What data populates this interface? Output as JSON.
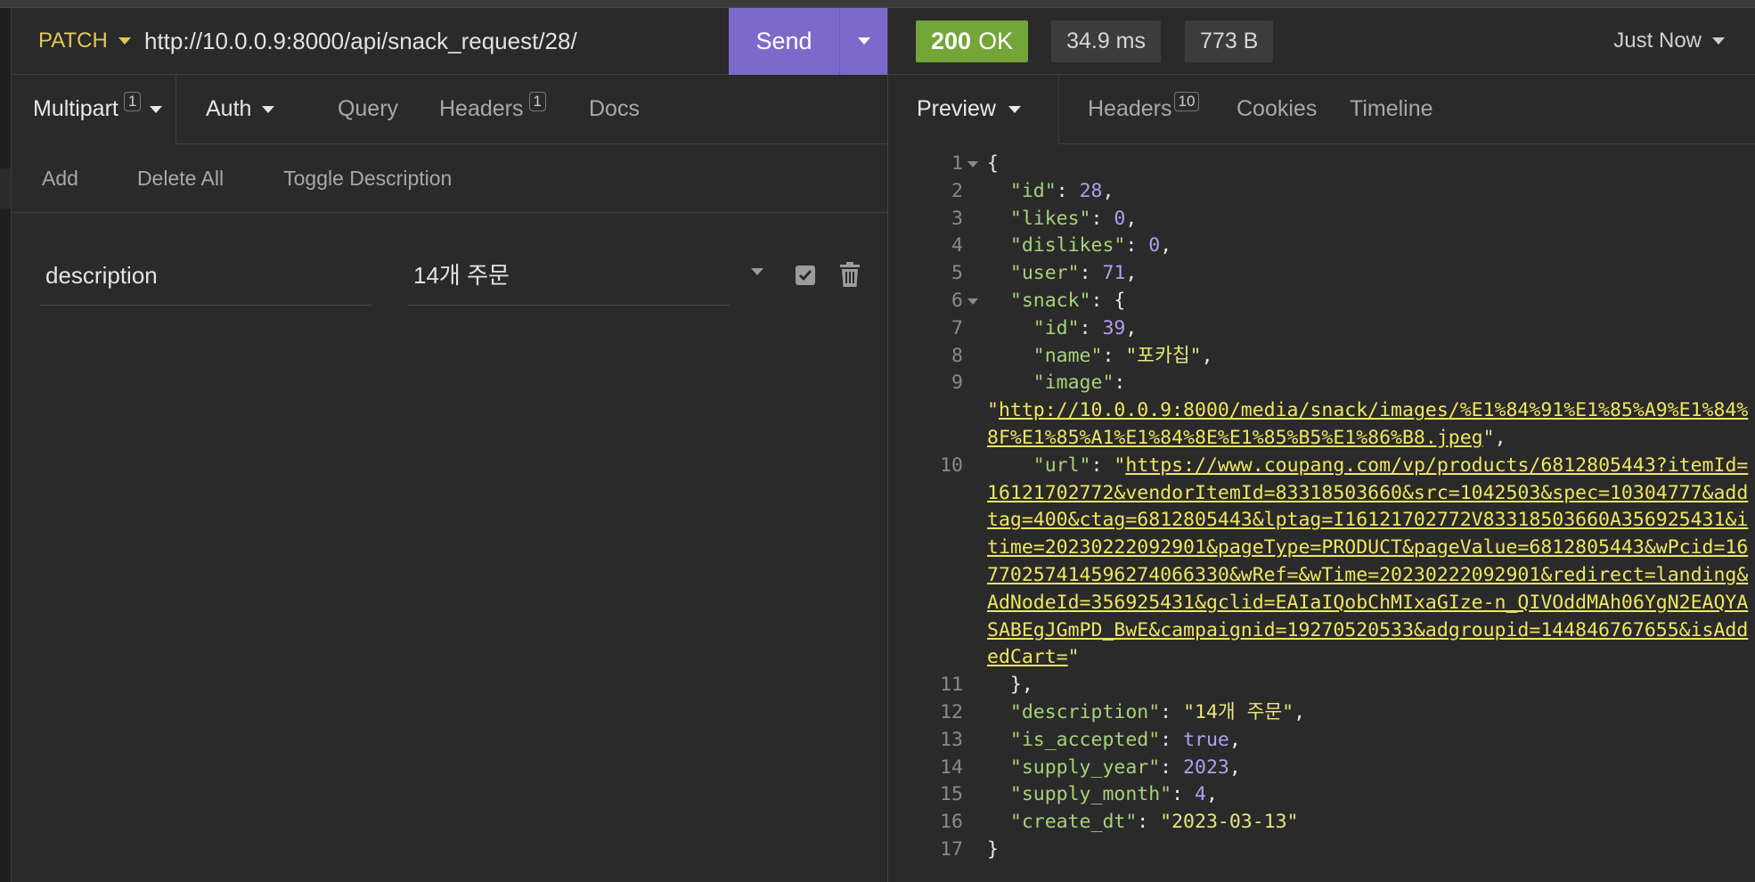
{
  "request": {
    "method": "PATCH",
    "url": "http://10.0.0.9:8000/api/snack_request/28/",
    "send_label": "Send",
    "tabs": [
      {
        "label": "Multipart",
        "badge": "1"
      },
      {
        "label": "Auth"
      },
      {
        "label": "Query"
      },
      {
        "label": "Headers",
        "badge": "1"
      },
      {
        "label": "Docs"
      }
    ],
    "actions": [
      "Add",
      "Delete All",
      "Toggle Description"
    ],
    "param": {
      "name": "description",
      "value": "14개 주문"
    }
  },
  "response": {
    "status_code": "200",
    "status_text": "OK",
    "time": "34.9 ms",
    "size": "773 B",
    "timestamp": "Just Now",
    "tabs": [
      {
        "label": "Preview"
      },
      {
        "label": "Headers",
        "badge": "10"
      },
      {
        "label": "Cookies"
      },
      {
        "label": "Timeline"
      }
    ],
    "lines": [
      {
        "n": "1",
        "fold": true,
        "parts": [
          [
            "p",
            "{"
          ]
        ]
      },
      {
        "n": "2",
        "parts": [
          [
            "p",
            "  "
          ],
          [
            "k",
            "\"id\""
          ],
          [
            "p",
            ": "
          ],
          [
            "n",
            "28"
          ],
          [
            "p",
            ","
          ]
        ]
      },
      {
        "n": "3",
        "parts": [
          [
            "p",
            "  "
          ],
          [
            "k",
            "\"likes\""
          ],
          [
            "p",
            ": "
          ],
          [
            "n",
            "0"
          ],
          [
            "p",
            ","
          ]
        ]
      },
      {
        "n": "4",
        "parts": [
          [
            "p",
            "  "
          ],
          [
            "k",
            "\"dislikes\""
          ],
          [
            "p",
            ": "
          ],
          [
            "n",
            "0"
          ],
          [
            "p",
            ","
          ]
        ]
      },
      {
        "n": "5",
        "parts": [
          [
            "p",
            "  "
          ],
          [
            "k",
            "\"user\""
          ],
          [
            "p",
            ": "
          ],
          [
            "n",
            "71"
          ],
          [
            "p",
            ","
          ]
        ]
      },
      {
        "n": "6",
        "fold": true,
        "parts": [
          [
            "p",
            "  "
          ],
          [
            "k",
            "\"snack\""
          ],
          [
            "p",
            ": {"
          ]
        ]
      },
      {
        "n": "7",
        "parts": [
          [
            "p",
            "    "
          ],
          [
            "k",
            "\"id\""
          ],
          [
            "p",
            ": "
          ],
          [
            "n",
            "39"
          ],
          [
            "p",
            ","
          ]
        ]
      },
      {
        "n": "8",
        "parts": [
          [
            "p",
            "    "
          ],
          [
            "k",
            "\"name\""
          ],
          [
            "p",
            ": "
          ],
          [
            "s",
            "\"포카칩\""
          ],
          [
            "p",
            ","
          ]
        ]
      },
      {
        "n": "9",
        "parts": [
          [
            "p",
            "    "
          ],
          [
            "k",
            "\"image\""
          ],
          [
            "p",
            ":"
          ]
        ]
      },
      {
        "n": "",
        "parts": [
          [
            "s",
            "\""
          ],
          [
            "lnk",
            "http://10.0.0.9:8000/media/snack/images/%E1%84%91%E1%85%A9%E1%84%8F%E1%85%A1%E1%84%8E%E1%85%B5%E1%86%B8.jpeg"
          ],
          [
            "s",
            "\""
          ],
          [
            "p",
            ","
          ]
        ]
      },
      {
        "n": "10",
        "parts": [
          [
            "p",
            "    "
          ],
          [
            "k",
            "\"url\""
          ],
          [
            "p",
            ": "
          ],
          [
            "s",
            "\""
          ],
          [
            "lnk",
            "https://www.coupang.com/vp/products/6812805443?itemId=16121702772&vendorItemId=83318503660&src=1042503&spec=10304777&addtag=400&ctag=6812805443&lptag=I16121702772V83318503660A356925431&itime=20230222092901&pageType=PRODUCT&pageValue=6812805443&wPcid=16770257414596274066330&wRef=&wTime=20230222092901&redirect=landing&AdNodeId=356925431&gclid=EAIaIQobChMIxaGIze-n_QIVOddMAh06YgN2EAQYASABEgJGmPD_BwE&campaignid=19270520533&adgroupid=144846767655&isAddedCart="
          ],
          [
            "s",
            "\""
          ]
        ]
      },
      {
        "n": "11",
        "parts": [
          [
            "p",
            "  },"
          ]
        ]
      },
      {
        "n": "12",
        "parts": [
          [
            "p",
            "  "
          ],
          [
            "k",
            "\"description\""
          ],
          [
            "p",
            ": "
          ],
          [
            "s",
            "\"14개 주문\""
          ],
          [
            "p",
            ","
          ]
        ]
      },
      {
        "n": "13",
        "parts": [
          [
            "p",
            "  "
          ],
          [
            "k",
            "\"is_accepted\""
          ],
          [
            "p",
            ": "
          ],
          [
            "n",
            "true"
          ],
          [
            "p",
            ","
          ]
        ]
      },
      {
        "n": "14",
        "parts": [
          [
            "p",
            "  "
          ],
          [
            "k",
            "\"supply_year\""
          ],
          [
            "p",
            ": "
          ],
          [
            "n",
            "2023"
          ],
          [
            "p",
            ","
          ]
        ]
      },
      {
        "n": "15",
        "parts": [
          [
            "p",
            "  "
          ],
          [
            "k",
            "\"supply_month\""
          ],
          [
            "p",
            ": "
          ],
          [
            "n",
            "4"
          ],
          [
            "p",
            ","
          ]
        ]
      },
      {
        "n": "16",
        "parts": [
          [
            "p",
            "  "
          ],
          [
            "k",
            "\"create_dt\""
          ],
          [
            "p",
            ": "
          ],
          [
            "s",
            "\"2023-03-13\""
          ]
        ]
      },
      {
        "n": "17",
        "parts": [
          [
            "p",
            "}"
          ]
        ]
      }
    ]
  },
  "colors": {
    "method": "#e3c757",
    "send_button": "#7d69cb",
    "status_ok": "#73a538",
    "json_key": "#a6d27a",
    "json_number": "#b39ef0",
    "json_string": "#e9e47a"
  },
  "icons": {
    "method_dropdown": "chevron-down-icon",
    "send_dropdown": "chevron-down-icon",
    "param_dropdown": "chevron-down-icon",
    "param_toggle": "checkbox-icon",
    "param_delete": "trash-icon",
    "code_fold": "fold-arrow-icon"
  }
}
